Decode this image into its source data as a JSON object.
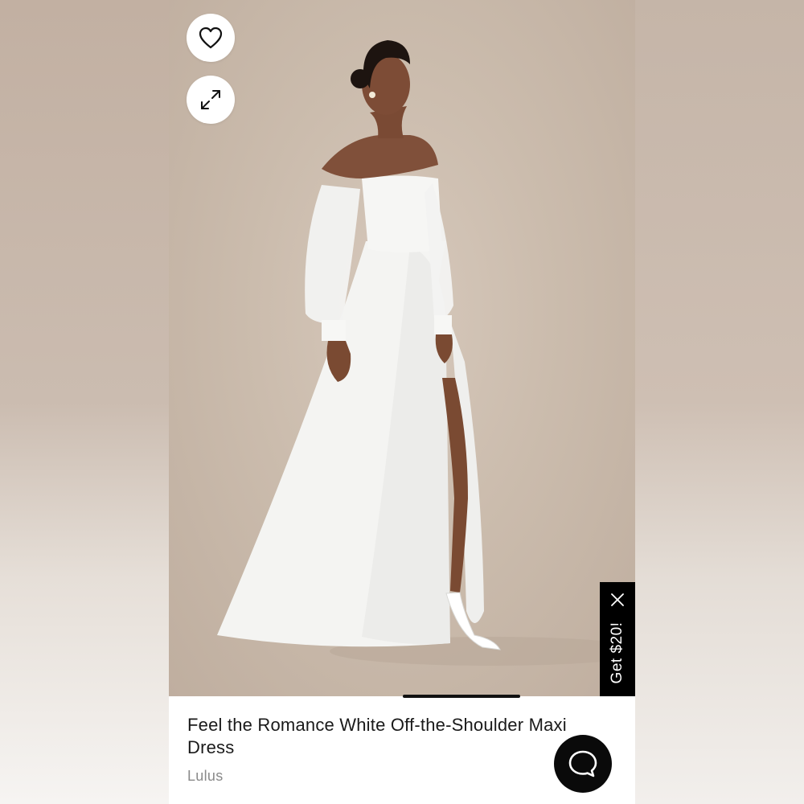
{
  "product": {
    "title": "Feel the Romance White Off-the-Shoulder Maxi Dress",
    "brand": "Lulus"
  },
  "promo": {
    "label": "Get $20!"
  },
  "icons": {
    "favorite": "heart-icon",
    "expand": "expand-arrows-icon",
    "promo_close": "close-icon",
    "chat": "chat-bubble-icon"
  },
  "colors": {
    "promo_bg": "#000000",
    "chat_bg": "#0a0a0a",
    "brand_text": "#8a8a8a",
    "title_text": "#1a1a1a"
  }
}
